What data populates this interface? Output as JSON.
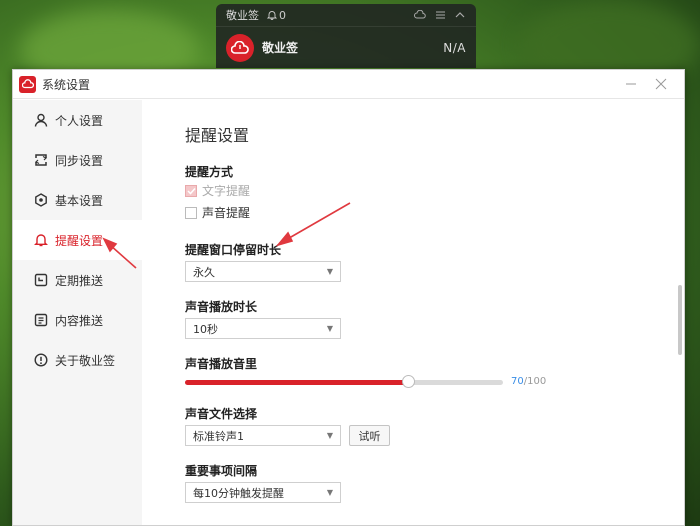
{
  "widget": {
    "title": "敬业签",
    "bell_count": "0",
    "name": "敬业签",
    "value": "N/A"
  },
  "window": {
    "title": "系统设置"
  },
  "sidebar": {
    "items": [
      {
        "label": "个人设置",
        "icon": "user-icon"
      },
      {
        "label": "同步设置",
        "icon": "sync-icon"
      },
      {
        "label": "基本设置",
        "icon": "settings-icon"
      },
      {
        "label": "提醒设置",
        "icon": "bell-icon",
        "active": true
      },
      {
        "label": "定期推送",
        "icon": "calendar-icon"
      },
      {
        "label": "内容推送",
        "icon": "document-icon"
      },
      {
        "label": "关于敬业签",
        "icon": "info-icon"
      }
    ]
  },
  "content": {
    "title": "提醒设置",
    "remind_method": {
      "title": "提醒方式",
      "text_remind": "文字提醒",
      "text_remind_checked": true,
      "sound_remind": "声音提醒",
      "sound_remind_checked": false
    },
    "window_duration": {
      "title": "提醒窗口停留时长",
      "value": "永久"
    },
    "sound_duration": {
      "title": "声音播放时长",
      "value": "10秒"
    },
    "sound_volume": {
      "title": "声音播放音里",
      "current": "70",
      "max": "/100",
      "level": 0.7
    },
    "sound_file": {
      "title": "声音文件选择",
      "value": "标准铃声1",
      "listen_button": "试听"
    },
    "important_interval": {
      "title": "重要事项间隔",
      "value": "每10分钟触发提醒"
    }
  },
  "colors": {
    "accent": "#d9222a",
    "volume_text": "#3a8ee6",
    "annotation_arrow": "#e0393f"
  }
}
